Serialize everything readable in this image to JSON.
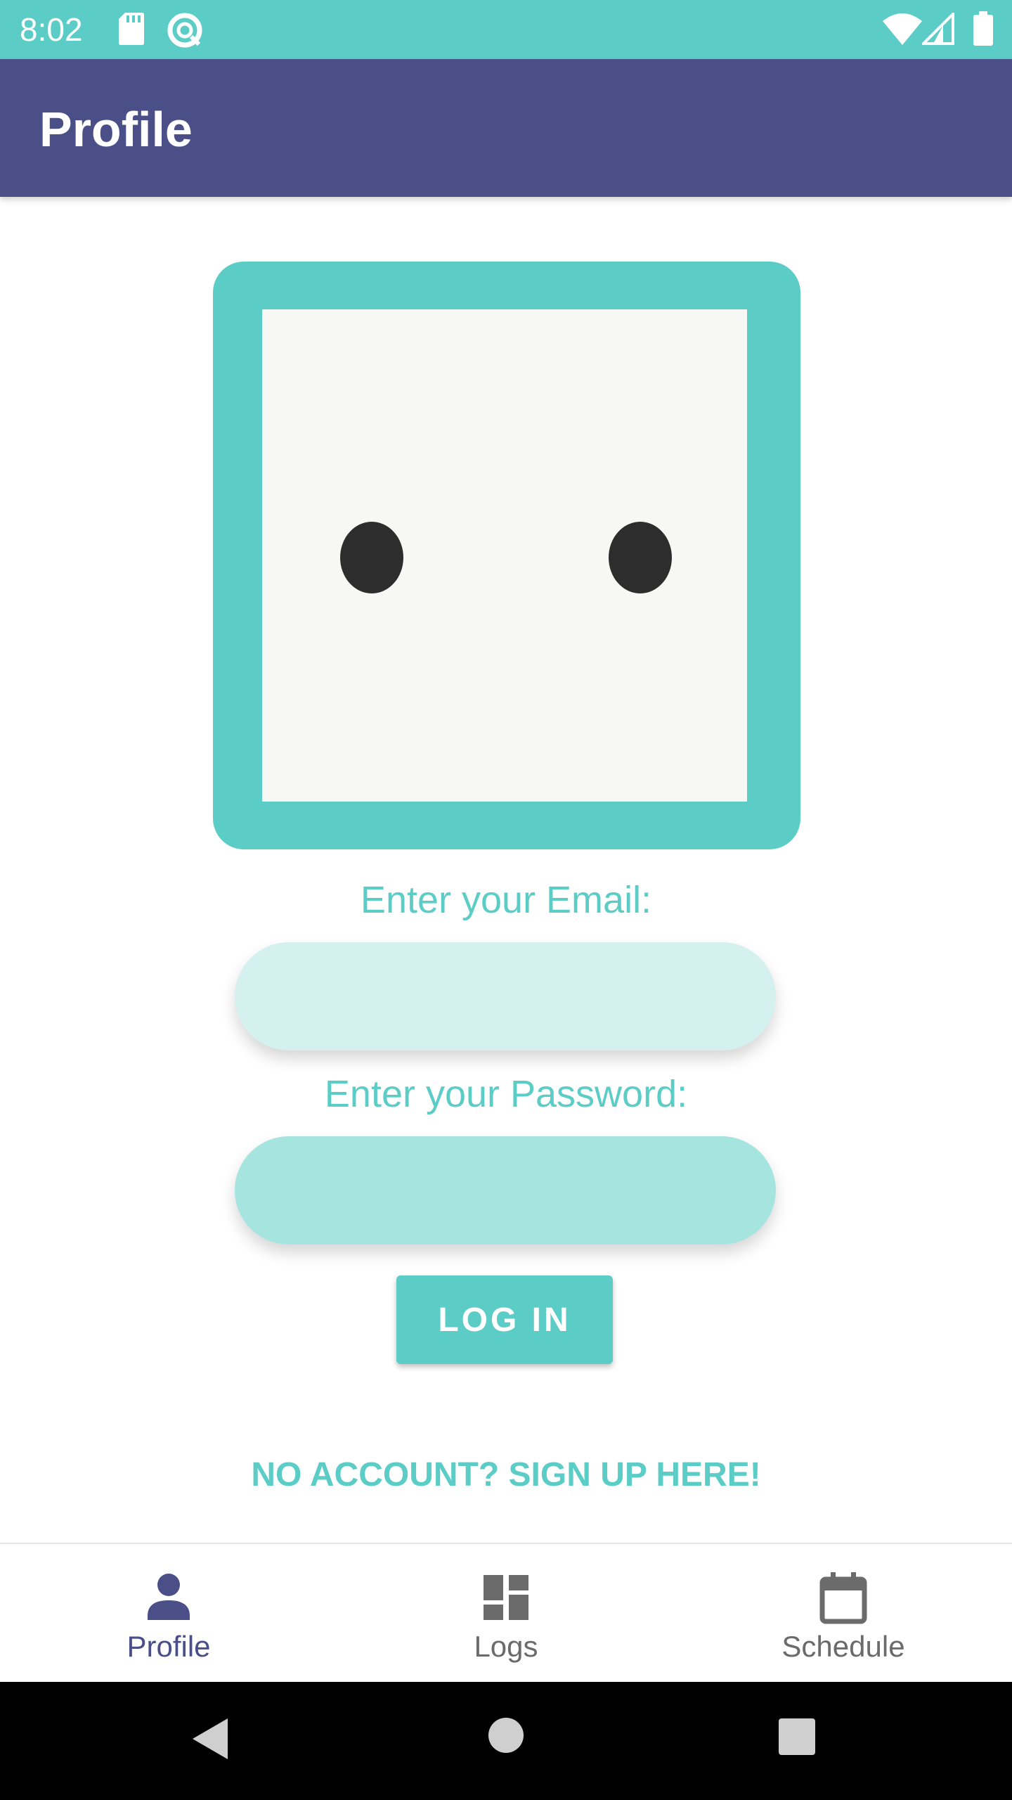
{
  "status_bar": {
    "time": "8:02",
    "left_icons": [
      "sd-card-icon",
      "data-saver-icon"
    ],
    "right_icons": [
      "wifi-icon",
      "cell-signal-icon",
      "battery-icon"
    ]
  },
  "app_bar": {
    "title": "Profile"
  },
  "login_form": {
    "email_label": "Enter your Email:",
    "email_value": "",
    "password_label": "Enter your Password:",
    "password_value": "",
    "login_button_label": "LOG IN",
    "signup_link_label": "NO ACCOUNT? SIGN UP HERE!"
  },
  "bottom_nav": {
    "items": [
      {
        "label": "Profile",
        "icon": "person-icon",
        "active": true
      },
      {
        "label": "Logs",
        "icon": "dashboard-icon",
        "active": false
      },
      {
        "label": "Schedule",
        "icon": "calendar-icon",
        "active": false
      }
    ]
  },
  "system_nav": {
    "buttons": [
      "back-icon",
      "home-icon",
      "recents-icon"
    ]
  },
  "colors": {
    "accent": "#5ccdc6",
    "primary": "#4a5087",
    "email_field_bg": "#d4f1ef",
    "password_field_bg": "#a6e4e0",
    "inactive": "#6b6b6b"
  }
}
